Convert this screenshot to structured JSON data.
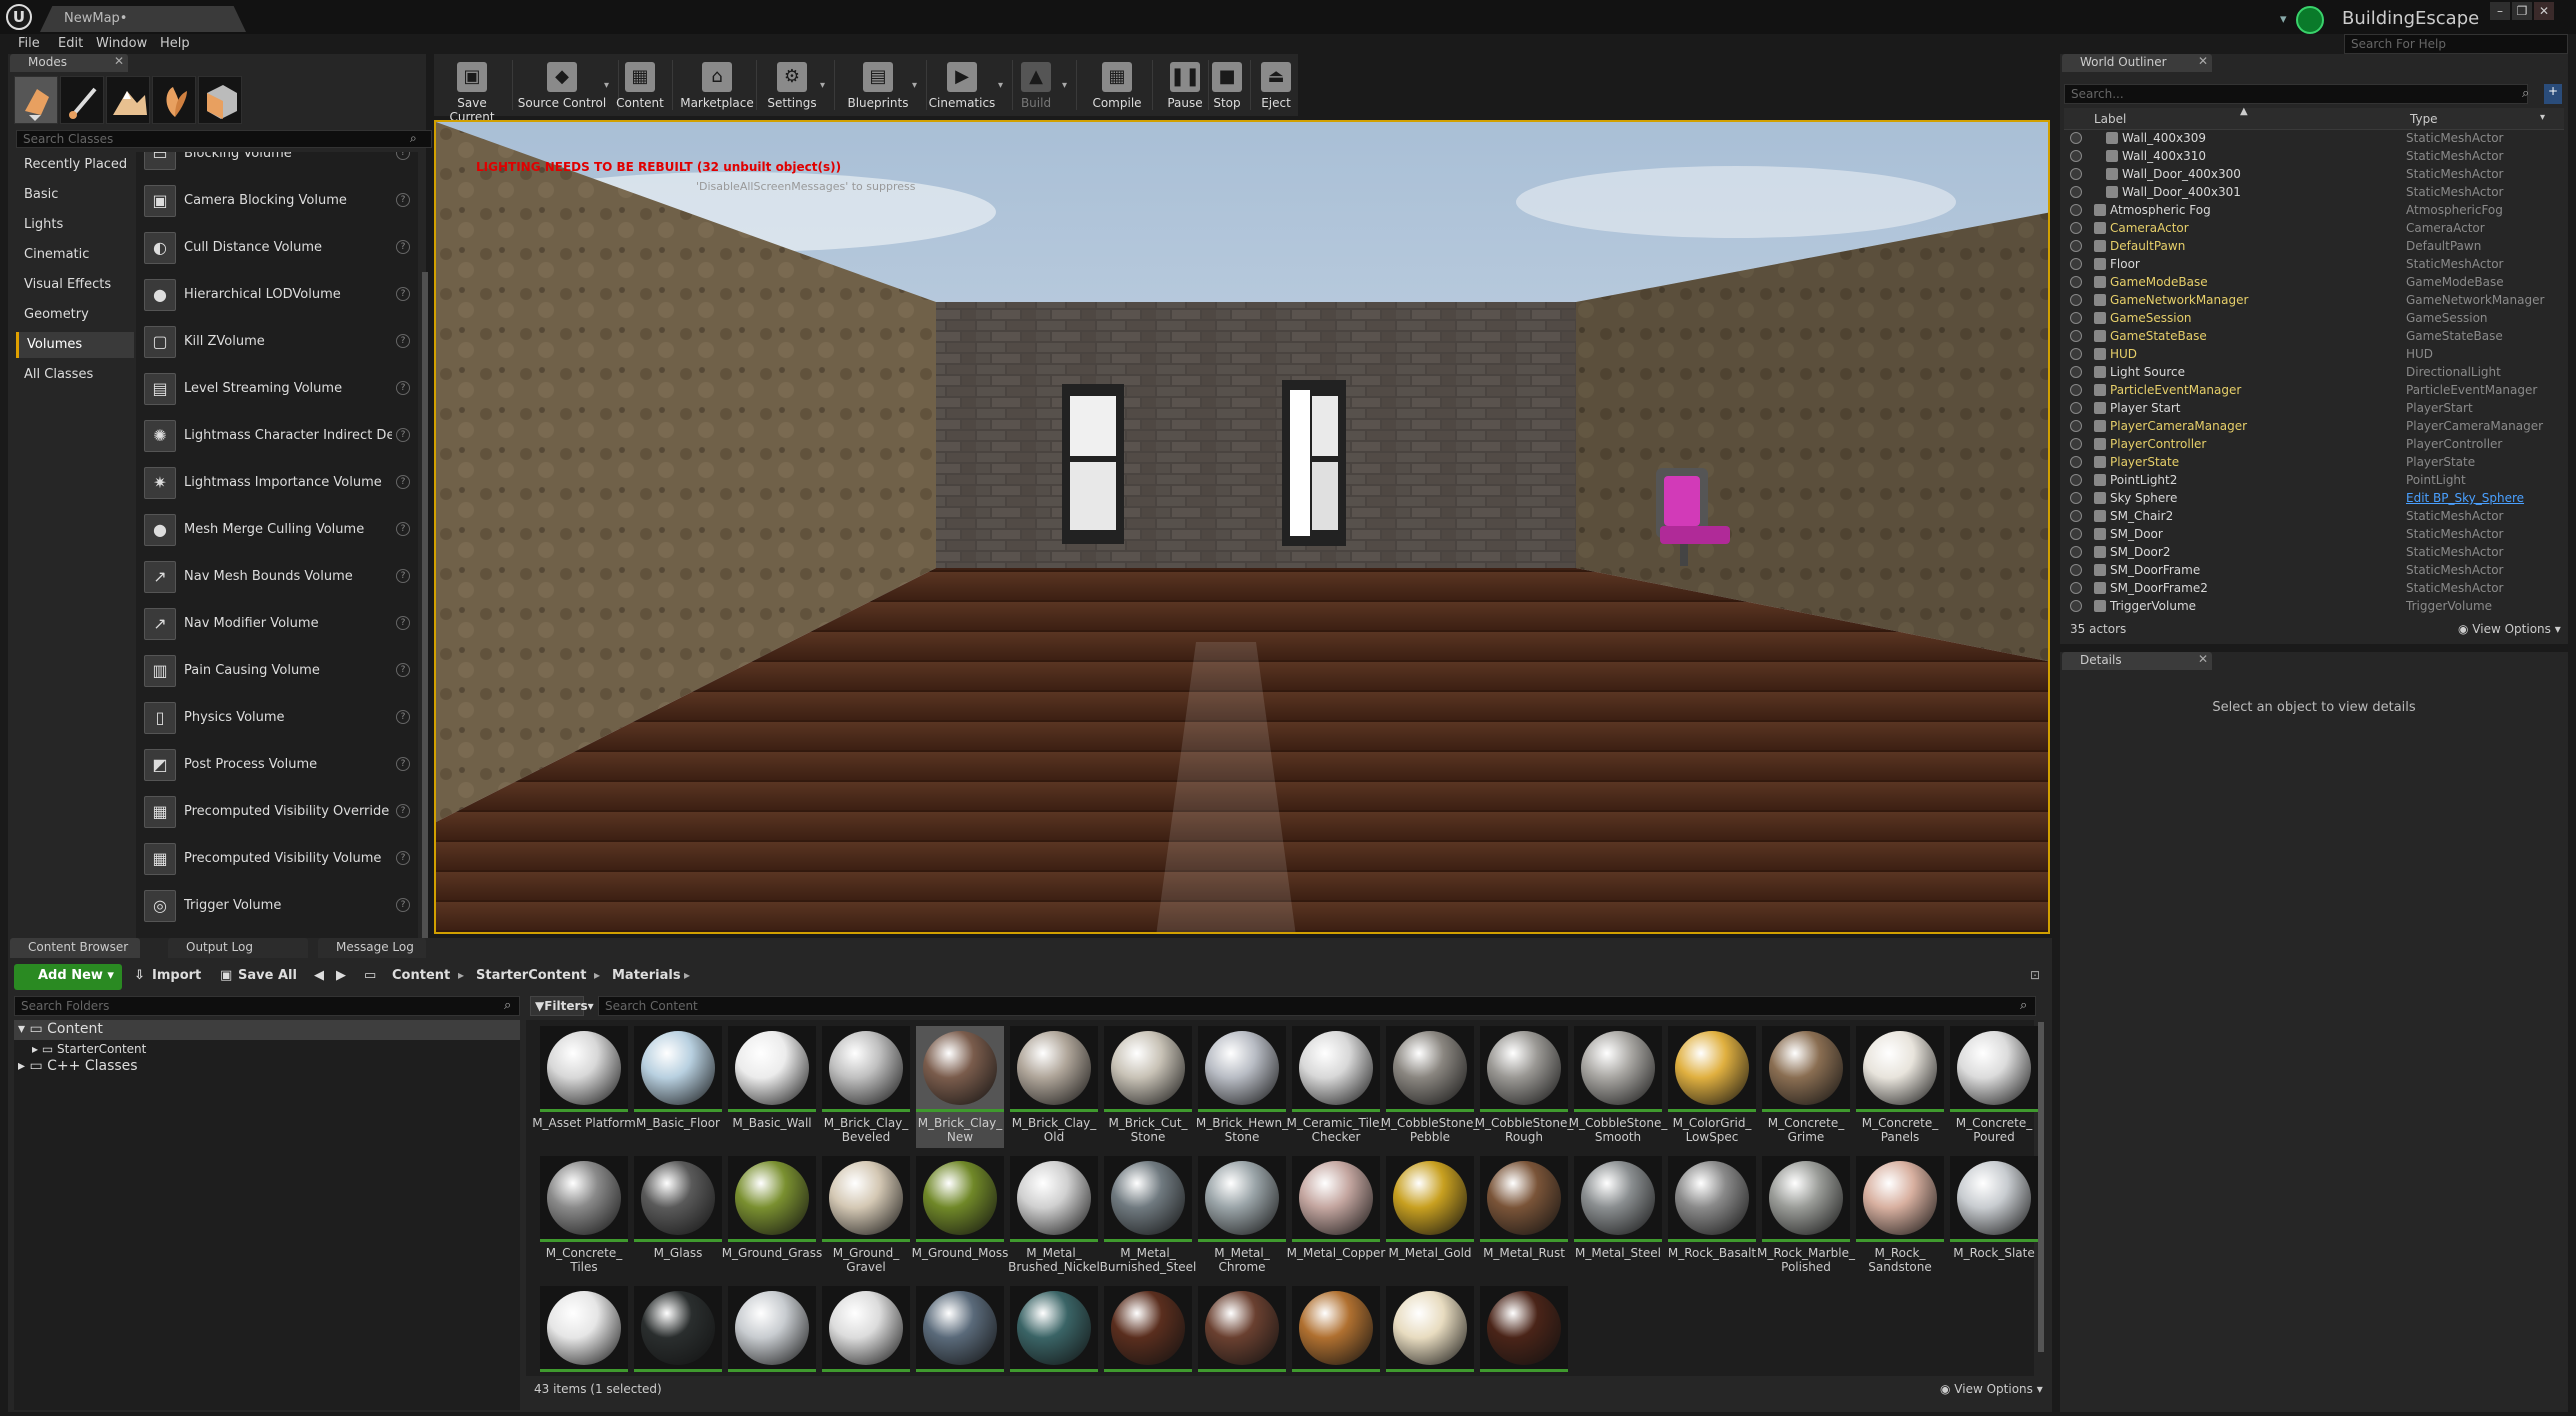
{
  "window": {
    "doc_tab": "NewMap•",
    "project": "BuildingEscape",
    "help_search_placeholder": "Search For Help",
    "controls": [
      "–",
      "❐",
      "✕"
    ]
  },
  "menu": [
    "File",
    "Edit",
    "Window",
    "Help"
  ],
  "modes": {
    "tab": "Modes",
    "search_placeholder": "Search Classes",
    "categories": [
      {
        "label": "Recently Placed",
        "selected": false
      },
      {
        "label": "Basic",
        "selected": false
      },
      {
        "label": "Lights",
        "selected": false
      },
      {
        "label": "Cinematic",
        "selected": false
      },
      {
        "label": "Visual Effects",
        "selected": false
      },
      {
        "label": "Geometry",
        "selected": false
      },
      {
        "label": "Volumes",
        "selected": true
      },
      {
        "label": "All Classes",
        "selected": false
      }
    ],
    "volumes": [
      "Blocking Volume",
      "Camera Blocking Volume",
      "Cull Distance Volume",
      "Hierarchical LODVolume",
      "Kill ZVolume",
      "Level Streaming Volume",
      "Lightmass Character Indirect Detail Volume",
      "Lightmass Importance Volume",
      "Mesh Merge Culling Volume",
      "Nav Mesh Bounds Volume",
      "Nav Modifier Volume",
      "Pain Causing Volume",
      "Physics Volume",
      "Post Process Volume",
      "Precomputed Visibility Override Volume",
      "Precomputed Visibility Volume",
      "Trigger Volume"
    ]
  },
  "toolbar": [
    {
      "label": "Save Current",
      "icon": "save-icon",
      "glyph": "▣",
      "disabled": false
    },
    {
      "label": "Source Control",
      "icon": "source-control-icon",
      "glyph": "◆",
      "disabled": false
    },
    {
      "label": "Content",
      "icon": "content-icon",
      "glyph": "▦",
      "disabled": false
    },
    {
      "label": "Marketplace",
      "icon": "marketplace-icon",
      "glyph": "⌂",
      "disabled": false
    },
    {
      "label": "Settings",
      "icon": "settings-icon",
      "glyph": "⚙",
      "disabled": false
    },
    {
      "label": "Blueprints",
      "icon": "blueprints-icon",
      "glyph": "▤",
      "disabled": false
    },
    {
      "label": "Cinematics",
      "icon": "cinematics-icon",
      "glyph": "▶",
      "disabled": false
    },
    {
      "label": "Build",
      "icon": "build-icon",
      "glyph": "▲",
      "disabled": true
    },
    {
      "label": "Compile",
      "icon": "compile-icon",
      "glyph": "▦",
      "disabled": false
    },
    {
      "label": "Pause",
      "icon": "pause-icon",
      "glyph": "❚❚",
      "disabled": false
    },
    {
      "label": "Stop",
      "icon": "stop-icon",
      "glyph": "■",
      "disabled": false
    },
    {
      "label": "Eject",
      "icon": "eject-icon",
      "glyph": "⏏",
      "disabled": false
    }
  ],
  "viewport": {
    "warning": "LIGHTING NEEDS TO BE REBUILT (32 unbuilt object(s))",
    "suppress": "'DisableAllScreenMessages' to suppress"
  },
  "outliner": {
    "tab": "World Outliner",
    "search_placeholder": "Search...",
    "col_label": "Label",
    "col_type": "Type",
    "rows": [
      {
        "label": "Wall_400x309",
        "type": "StaticMeshActor",
        "indent": 2,
        "yellow": false,
        "link": false
      },
      {
        "label": "Wall_400x310",
        "type": "StaticMeshActor",
        "indent": 2,
        "yellow": false,
        "link": false
      },
      {
        "label": "Wall_Door_400x300",
        "type": "StaticMeshActor",
        "indent": 2,
        "yellow": false,
        "link": false
      },
      {
        "label": "Wall_Door_400x301",
        "type": "StaticMeshActor",
        "indent": 2,
        "yellow": false,
        "link": false
      },
      {
        "label": "Atmospheric Fog",
        "type": "AtmosphericFog",
        "indent": 1,
        "yellow": false,
        "link": false
      },
      {
        "label": "CameraActor",
        "type": "CameraActor",
        "indent": 1,
        "yellow": true,
        "link": false
      },
      {
        "label": "DefaultPawn",
        "type": "DefaultPawn",
        "indent": 1,
        "yellow": true,
        "link": false
      },
      {
        "label": "Floor",
        "type": "StaticMeshActor",
        "indent": 1,
        "yellow": false,
        "link": false
      },
      {
        "label": "GameModeBase",
        "type": "GameModeBase",
        "indent": 1,
        "yellow": true,
        "link": false
      },
      {
        "label": "GameNetworkManager",
        "type": "GameNetworkManager",
        "indent": 1,
        "yellow": true,
        "link": false
      },
      {
        "label": "GameSession",
        "type": "GameSession",
        "indent": 1,
        "yellow": true,
        "link": false
      },
      {
        "label": "GameStateBase",
        "type": "GameStateBase",
        "indent": 1,
        "yellow": true,
        "link": false
      },
      {
        "label": "HUD",
        "type": "HUD",
        "indent": 1,
        "yellow": true,
        "link": false
      },
      {
        "label": "Light Source",
        "type": "DirectionalLight",
        "indent": 1,
        "yellow": false,
        "link": false
      },
      {
        "label": "ParticleEventManager",
        "type": "ParticleEventManager",
        "indent": 1,
        "yellow": true,
        "link": false
      },
      {
        "label": "Player Start",
        "type": "PlayerStart",
        "indent": 1,
        "yellow": false,
        "link": false
      },
      {
        "label": "PlayerCameraManager",
        "type": "PlayerCameraManager",
        "indent": 1,
        "yellow": true,
        "link": false
      },
      {
        "label": "PlayerController",
        "type": "PlayerController",
        "indent": 1,
        "yellow": true,
        "link": false
      },
      {
        "label": "PlayerState",
        "type": "PlayerState",
        "indent": 1,
        "yellow": true,
        "link": false
      },
      {
        "label": "PointLight2",
        "type": "PointLight",
        "indent": 1,
        "yellow": false,
        "link": false
      },
      {
        "label": "Sky Sphere",
        "type": "Edit BP_Sky_Sphere",
        "indent": 1,
        "yellow": false,
        "link": true
      },
      {
        "label": "SM_Chair2",
        "type": "StaticMeshActor",
        "indent": 1,
        "yellow": false,
        "link": false
      },
      {
        "label": "SM_Door",
        "type": "StaticMeshActor",
        "indent": 1,
        "yellow": false,
        "link": false
      },
      {
        "label": "SM_Door2",
        "type": "StaticMeshActor",
        "indent": 1,
        "yellow": false,
        "link": false
      },
      {
        "label": "SM_DoorFrame",
        "type": "StaticMeshActor",
        "indent": 1,
        "yellow": false,
        "link": false
      },
      {
        "label": "SM_DoorFrame2",
        "type": "StaticMeshActor",
        "indent": 1,
        "yellow": false,
        "link": false
      },
      {
        "label": "TriggerVolume",
        "type": "TriggerVolume",
        "indent": 1,
        "yellow": false,
        "link": false
      }
    ],
    "count": "35 actors",
    "view_options": "View Options"
  },
  "details": {
    "tab": "Details",
    "message": "Select an object to view details"
  },
  "content_browser": {
    "tabs": [
      "Content Browser",
      "Output Log",
      "Message Log"
    ],
    "add_new": "Add New",
    "import": "Import",
    "save_all": "Save All",
    "breadcrumb": [
      "Content",
      "StarterContent",
      "Materials"
    ],
    "folder_search_placeholder": "Search Folders",
    "tree": [
      "Content",
      "StarterContent",
      "C++ Classes"
    ],
    "filters": "Filters",
    "content_search_placeholder": "Search Content",
    "status": "43 items (1 selected)",
    "view_options": "View Options",
    "assets": [
      {
        "name": "M_Asset Platform",
        "color": "#d8d8d8"
      },
      {
        "name": "M_Basic_Floor",
        "color": "#b8d0e0"
      },
      {
        "name": "M_Basic_Wall",
        "color": "#ececec"
      },
      {
        "name": "M_Brick_Clay_ Beveled",
        "color": "#c0c0c0"
      },
      {
        "name": "M_Brick_Clay_ New",
        "color": "#7a5c4c",
        "selected": true
      },
      {
        "name": "M_Brick_Clay_ Old",
        "color": "#b0a69a"
      },
      {
        "name": "M_Brick_Cut_ Stone",
        "color": "#c8c2b6"
      },
      {
        "name": "M_Brick_Hewn_ Stone",
        "color": "#b8bcc4"
      },
      {
        "name": "M_Ceramic_Tile_ Checker",
        "color": "#d8d8d8"
      },
      {
        "name": "M_CobbleStone_ Pebble",
        "color": "#8a8680"
      },
      {
        "name": "M_CobbleStone_ Rough",
        "color": "#9a9894"
      },
      {
        "name": "M_CobbleStone_ Smooth",
        "color": "#a8a6a2"
      },
      {
        "name": "M_ColorGrid_ LowSpec",
        "color": "#e0b040"
      },
      {
        "name": "M_Concrete_ Grime",
        "color": "#8a6e52"
      },
      {
        "name": "M_Concrete_ Panels",
        "color": "#e8e4dc"
      },
      {
        "name": "M_Concrete_ Poured",
        "color": "#dcdcdc"
      },
      {
        "name": "M_Concrete_ Tiles",
        "color": "#8a8a8a"
      },
      {
        "name": "M_Glass",
        "color": "#5a5a5a"
      },
      {
        "name": "M_Ground_Grass",
        "color": "#7a9030"
      },
      {
        "name": "M_Ground_ Gravel",
        "color": "#d4c8b4"
      },
      {
        "name": "M_Ground_Moss",
        "color": "#708828"
      },
      {
        "name": "M_Metal_ Brushed_Nickel",
        "color": "#d0d0d0"
      },
      {
        "name": "M_Metal_ Burnished_Steel",
        "color": "#707a80"
      },
      {
        "name": "M_Metal_ Chrome",
        "color": "#9aa4a8"
      },
      {
        "name": "M_Metal_Copper",
        "color": "#c4a6a0"
      },
      {
        "name": "M_Metal_Gold",
        "color": "#c8a020"
      },
      {
        "name": "M_Metal_Rust",
        "color": "#7a5438"
      },
      {
        "name": "M_Metal_Steel",
        "color": "#8a8e90"
      },
      {
        "name": "M_Rock_Basalt",
        "color": "#8a8a8a"
      },
      {
        "name": "M_Rock_Marble_ Polished",
        "color": "#9a9c98"
      },
      {
        "name": "M_Rock_ Sandstone",
        "color": "#d8b0a0"
      },
      {
        "name": "M_Rock_Slate",
        "color": "#c8ccd0"
      },
      {
        "name": "",
        "color": "#e6e6e6"
      },
      {
        "name": "",
        "color": "#2a2e2e"
      },
      {
        "name": "",
        "color": "#c8ccd0"
      },
      {
        "name": "",
        "color": "#dcdcdc"
      },
      {
        "name": "",
        "color": "#5a6a7a"
      },
      {
        "name": "",
        "color": "#3a6466"
      },
      {
        "name": "",
        "color": "#5a2e1e"
      },
      {
        "name": "",
        "color": "#6a4030"
      },
      {
        "name": "",
        "color": "#b07030"
      },
      {
        "name": "",
        "color": "#e8dcc0"
      },
      {
        "name": "",
        "color": "#4a2418"
      }
    ]
  }
}
